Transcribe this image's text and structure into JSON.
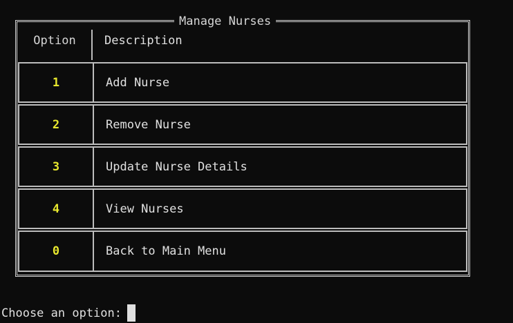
{
  "menu": {
    "title": "Manage Nurses",
    "header": {
      "option": "Option",
      "description": "Description"
    },
    "items": [
      {
        "option": "1",
        "description": "Add Nurse"
      },
      {
        "option": "2",
        "description": "Remove Nurse"
      },
      {
        "option": "3",
        "description": "Update Nurse Details"
      },
      {
        "option": "4",
        "description": "View Nurses"
      },
      {
        "option": "0",
        "description": "Back to Main Menu"
      }
    ]
  },
  "prompt": {
    "label": "Choose an option:"
  },
  "colors": {
    "background": "#0c0c0c",
    "option_number": "#e8e82e",
    "text": "#e0e0e0",
    "border": "#d6d6d6"
  }
}
